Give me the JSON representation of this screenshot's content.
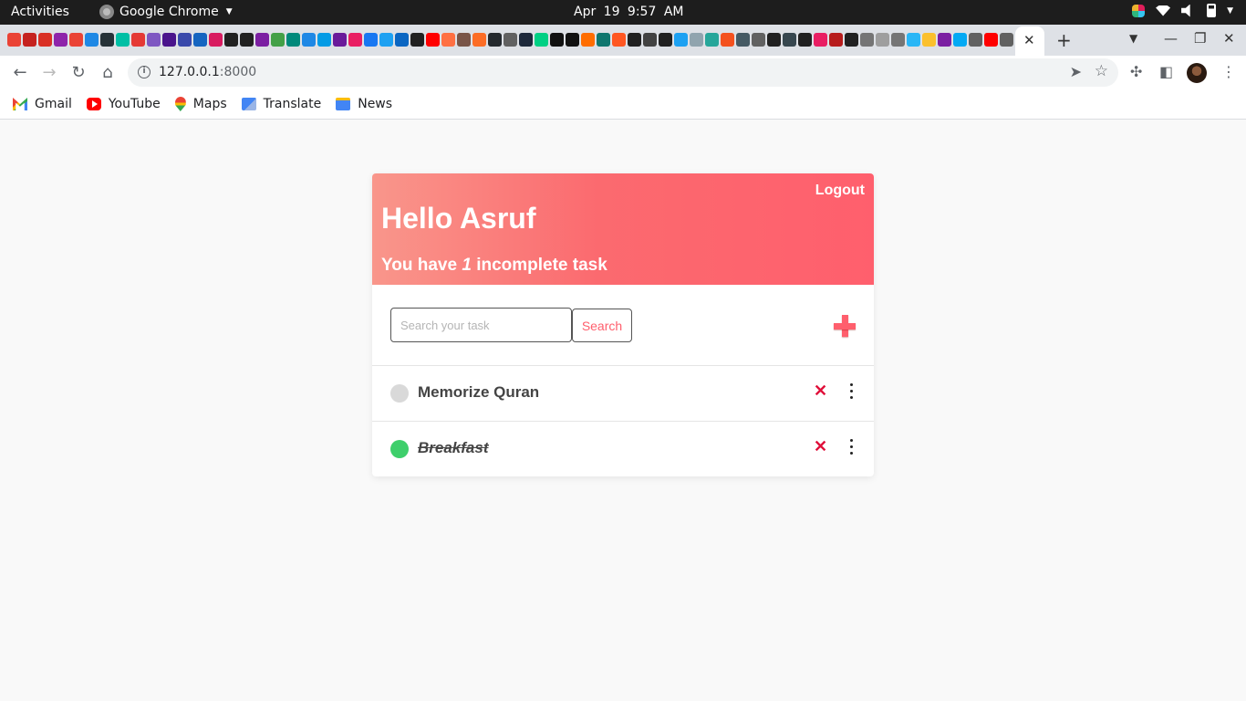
{
  "system_bar": {
    "activities": "Activities",
    "app_name": "Google Chrome",
    "clock": "Apr 19  9:57 AM"
  },
  "tabs": {
    "favicon_colors": [
      "#ea4335",
      "#c5221f",
      "#d93025",
      "#8e24aa",
      "#ea4335",
      "#1e88e5",
      "#263238",
      "#00bfa5",
      "#e53935",
      "#7e57c2",
      "#4a148c",
      "#3949ab",
      "#1565c0",
      "#d81b60",
      "#212121",
      "#212121",
      "#7b1fa2",
      "#43a047",
      "#00897b",
      "#1e88e5",
      "#039be5",
      "#6a1b9a",
      "#e91e63",
      "#1877f2",
      "#1da1f2",
      "#0a66c2",
      "#212121",
      "#ff0000",
      "#ff7043",
      "#795548",
      "#fc6d26",
      "#24292e",
      "#616161",
      "#1e293b",
      "#00d084",
      "#111111",
      "#111111",
      "#ff6d00",
      "#0f766e",
      "#ff5722",
      "#212121",
      "#424242",
      "#212121",
      "#1da1f2",
      "#90a4ae",
      "#26a69a",
      "#f4511e",
      "#455a64",
      "#616161",
      "#212121",
      "#37474f",
      "#212121",
      "#e91e63",
      "#b71c1c",
      "#212121",
      "#757575",
      "#9e9e9e",
      "#757575",
      "#29b6f6",
      "#fbc02d",
      "#7b1fa2",
      "#03a9f4",
      "#616161",
      "#ff0000",
      "#616161"
    ],
    "active_tab_close": "✕",
    "new_tab": "+"
  },
  "toolbar": {
    "url_host": "127.0.0.1",
    "url_port": ":8000"
  },
  "bookmarks": [
    {
      "label": "Gmail",
      "icon": "gmail-icon"
    },
    {
      "label": "YouTube",
      "icon": "youtube-icon"
    },
    {
      "label": "Maps",
      "icon": "maps-icon"
    },
    {
      "label": "Translate",
      "icon": "translate-icon"
    },
    {
      "label": "News",
      "icon": "news-icon"
    }
  ],
  "app": {
    "logout": "Logout",
    "greeting": "Hello Asruf",
    "summary_prefix": "You have ",
    "incomplete_count": "1",
    "summary_suffix": " incomplete task",
    "search_placeholder": "Search your task",
    "search_button": "Search",
    "accent_color": "#ff5f6d",
    "tasks": [
      {
        "title": "Memorize Quran",
        "completed": false,
        "status_color": "#d9d9d9",
        "delete": "✕"
      },
      {
        "title": "Breakfast",
        "completed": true,
        "status_color": "#3ecf6b",
        "delete": "✕"
      }
    ]
  }
}
